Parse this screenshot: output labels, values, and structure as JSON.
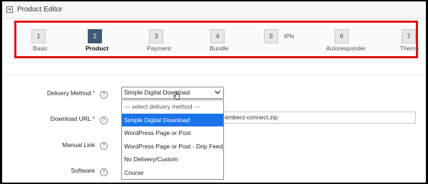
{
  "panel": {
    "title": "Product Editor"
  },
  "steps": [
    {
      "number": "1",
      "label": "Basic"
    },
    {
      "number": "2",
      "label": "Product"
    },
    {
      "number": "3",
      "label": "Payment"
    },
    {
      "number": "4",
      "label": "Bundle"
    },
    {
      "number": "5",
      "label": "IPN"
    },
    {
      "number": "6",
      "label": "Autoresponder"
    },
    {
      "number": "7",
      "label": "Theme"
    }
  ],
  "form": {
    "required_marker": "*",
    "help_glyph": "?",
    "delivery_method": {
      "label": "Delivery Method",
      "selected": "Simple Digital Download",
      "options": [
        "--- select delivery method ---",
        "Simple Digital Download",
        "WordPress Page or Post",
        "WordPress Page or Post - Drip Feed",
        "No Delivery/Custom",
        "Course"
      ]
    },
    "download_url": {
      "label": "Download URL",
      "value_visible": "emberz-connect.zip"
    },
    "manual_link": {
      "label": "Manual Link"
    },
    "software": {
      "label": "Software"
    }
  },
  "colors": {
    "highlight_outline": "#e10e0e",
    "active_step": "#3f5a73",
    "dropdown_highlight": "#1a73e8"
  }
}
